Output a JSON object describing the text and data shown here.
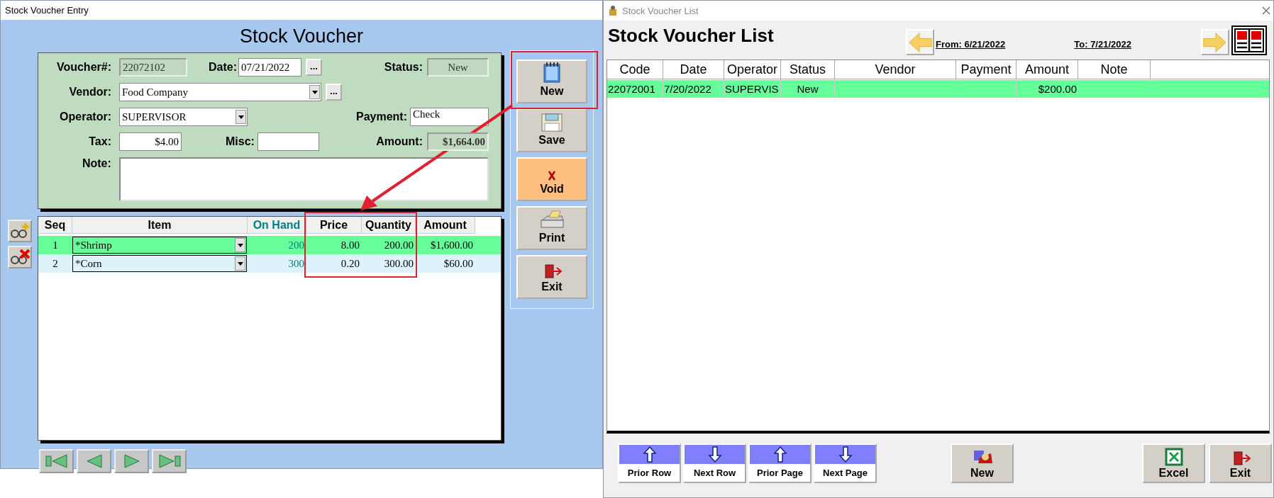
{
  "entry_window": {
    "title": "Stock Voucher Entry",
    "heading": "Stock Voucher",
    "form": {
      "voucher_label": "Voucher#:",
      "voucher": "22072102",
      "date_label": "Date:",
      "date": "07/21/2022",
      "date_button": "...",
      "status_label": "Status:",
      "status": "New",
      "vendor_label": "Vendor:",
      "vendor": "Food Company",
      "vendor_button": "...",
      "operator_label": "Operator:",
      "operator": "SUPERVISOR",
      "payment_label": "Payment:",
      "payment": "Check",
      "tax_label": "Tax:",
      "tax": "$4.00",
      "misc_label": "Misc:",
      "amount_label": "Amount:",
      "amount": "$1,664.00",
      "note_label": "Note:"
    },
    "columns": [
      "Seq",
      "Item",
      "On Hand",
      "Price",
      "Quantity",
      "Amount"
    ],
    "rows": [
      {
        "seq": "1",
        "item": "*Shrimp",
        "on_hand": "200",
        "price": "8.00",
        "quantity": "200.00",
        "amount": "$1,600.00",
        "selected": true
      },
      {
        "seq": "2",
        "item": "*Corn",
        "on_hand": "300",
        "price": "0.20",
        "quantity": "300.00",
        "amount": "$60.00",
        "selected": false
      }
    ],
    "buttons": [
      {
        "label": "New",
        "kind": "new"
      },
      {
        "label": "Save",
        "kind": "save"
      },
      {
        "label": "Void",
        "kind": "void"
      },
      {
        "label": "Print",
        "kind": "print"
      },
      {
        "label": "Exit",
        "kind": "exit"
      }
    ]
  },
  "list_window": {
    "title": "Stock Voucher List",
    "heading": "Stock Voucher List",
    "from": "From: 6/21/2022",
    "to": "To: 7/21/2022",
    "columns": [
      "Code",
      "Date",
      "Operator",
      "Status",
      "Vendor",
      "Payment",
      "Amount",
      "Note"
    ],
    "rows": [
      {
        "code": "22072001",
        "date": "7/20/2022",
        "operator": "SUPERVIS",
        "status": "New",
        "amount": "$200.00",
        "selected": true
      }
    ],
    "buttons": [
      {
        "label": "Prior Row",
        "kind": "prior_row"
      },
      {
        "label": "Next Row",
        "kind": "next_row"
      },
      {
        "label": "Prior Page",
        "kind": "prior_page"
      },
      {
        "label": "Next Page",
        "kind": "next_page"
      },
      {
        "label": "New",
        "kind": "new"
      },
      {
        "label": "Excel",
        "kind": "excel"
      },
      {
        "label": "Exit",
        "kind": "exit"
      }
    ]
  },
  "annotations": {
    "new_button_frame": true,
    "price_quantity_frame": true,
    "arrow": true
  }
}
